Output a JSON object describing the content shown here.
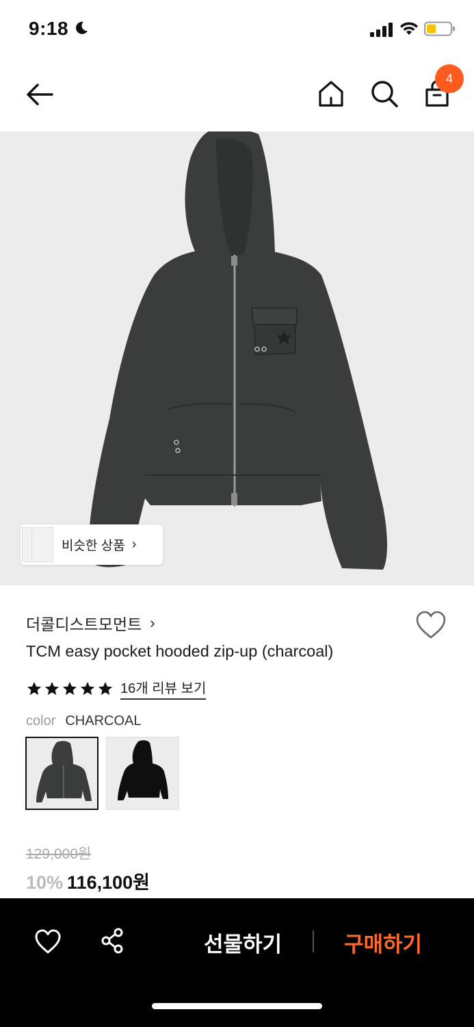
{
  "status_bar": {
    "time": "9:18",
    "icons": [
      "moon-icon",
      "signal-icon",
      "wifi-icon",
      "battery-icon"
    ]
  },
  "nav": {
    "icons": [
      "back-arrow-icon",
      "home-icon",
      "search-icon",
      "shopping-bag-icon"
    ],
    "cart_count": "4",
    "accent_color": "#ff5a1f"
  },
  "hero": {
    "similar_label": "비슷한 상품",
    "similar_chevron": "›"
  },
  "product": {
    "brand": "더콜디스트모먼트",
    "brand_chevron": "›",
    "title": "TCM easy pocket hooded zip-up (charcoal)",
    "rating_stars": 5,
    "review_link": "16개 리뷰 보기",
    "color_label": "color",
    "color_value": "CHARCOAL",
    "swatches": [
      {
        "name": "charcoal",
        "color": "#3a3d3c",
        "selected": true
      },
      {
        "name": "black",
        "color": "#0f0f0f",
        "selected": false
      }
    ],
    "original_price": "129,000원",
    "discount": "10%",
    "final_price": "116,100원"
  },
  "actions": {
    "gift_label": "선물하기",
    "buy_label": "구매하기",
    "buy_color": "#ff6a2a"
  }
}
